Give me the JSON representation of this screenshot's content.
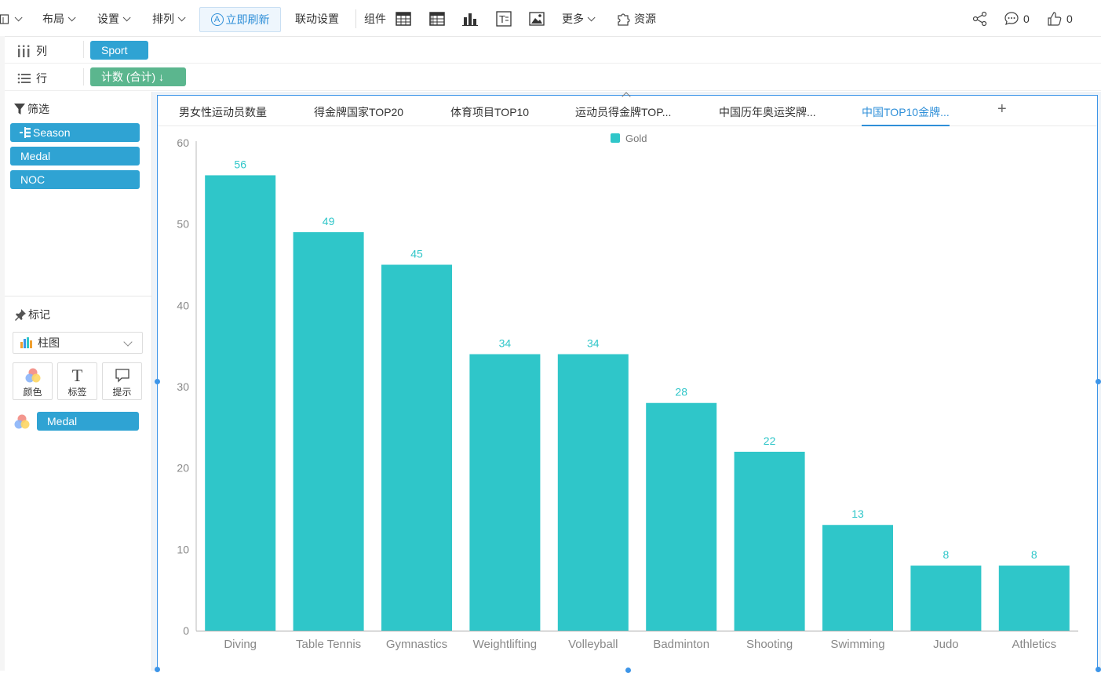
{
  "toolbar": {
    "items": [
      "布局",
      "设置",
      "排列"
    ],
    "refresh_label": "立即刷新",
    "link_settings_label": "联动设置",
    "components_label": "组件",
    "more_label": "更多",
    "resources_label": "资源",
    "comment_count": "0",
    "like_count": "0"
  },
  "shelves": {
    "columns_label": "列",
    "columns_pill": "Sport",
    "rows_label": "行",
    "rows_pill": "计数 (合计) ↓"
  },
  "filter": {
    "title": "筛选",
    "items": [
      "Season",
      "Medal",
      "NOC"
    ]
  },
  "marks": {
    "title": "标记",
    "chart_type": "柱图",
    "color_label": "颜色",
    "label_label": "标签",
    "tooltip_label": "提示",
    "color_field": "Medal"
  },
  "tabs": [
    {
      "label": "男女性运动员数量"
    },
    {
      "label": "得金牌国家TOP20"
    },
    {
      "label": "体育项目TOP10"
    },
    {
      "label": "运动员得金牌TOP..."
    },
    {
      "label": "中国历年奥运奖牌..."
    },
    {
      "label": "中国TOP10金牌..."
    }
  ],
  "colors": {
    "bar": "#2fc6c9",
    "accent": "#2f8fd8",
    "pill_blue": "#2fa3d3",
    "pill_green": "#5bb68e"
  },
  "chart_data": {
    "type": "bar",
    "categories": [
      "Diving",
      "Table Tennis",
      "Gymnastics",
      "Weightlifting",
      "Volleyball",
      "Badminton",
      "Shooting",
      "Swimming",
      "Judo",
      "Athletics"
    ],
    "series": [
      {
        "name": "Gold",
        "values": [
          56,
          49,
          45,
          34,
          34,
          28,
          22,
          13,
          8,
          8
        ]
      }
    ],
    "yticks": [
      0,
      10,
      20,
      30,
      40,
      50,
      60
    ],
    "ylim": [
      0,
      60
    ],
    "legend": "top-center",
    "grid": false
  }
}
